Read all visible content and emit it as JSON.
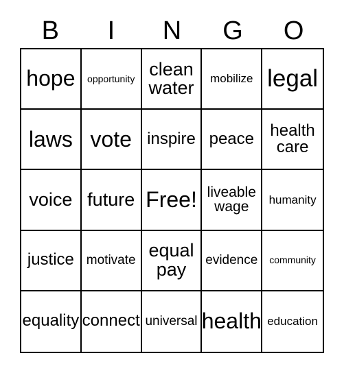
{
  "card": {
    "title": "BINGO",
    "header_letters": [
      "B",
      "I",
      "N",
      "G",
      "O"
    ],
    "border_color": "#000000",
    "background_color": "#ffffff",
    "text_color": "#000000",
    "rows": 5,
    "columns": 5,
    "cells": [
      {
        "text": "hope",
        "size": "lg"
      },
      {
        "text": "opportunity",
        "size": "tiny"
      },
      {
        "text": "clean\nwater",
        "size": "ml"
      },
      {
        "text": "mobilize",
        "size": "xxs"
      },
      {
        "text": "legal",
        "size": "xl"
      },
      {
        "text": "laws",
        "size": "lg"
      },
      {
        "text": "vote",
        "size": "lg"
      },
      {
        "text": "inspire",
        "size": "md"
      },
      {
        "text": "peace",
        "size": "md"
      },
      {
        "text": "health\ncare",
        "size": "md"
      },
      {
        "text": "voice",
        "size": "ml"
      },
      {
        "text": "future",
        "size": "ml"
      },
      {
        "text": "Free!",
        "size": "lg"
      },
      {
        "text": "liveable\nwage",
        "size": "sm"
      },
      {
        "text": "humanity",
        "size": "xxs"
      },
      {
        "text": "justice",
        "size": "md"
      },
      {
        "text": "motivate",
        "size": "xs"
      },
      {
        "text": "equal\npay",
        "size": "ml"
      },
      {
        "text": "evidence",
        "size": "xs"
      },
      {
        "text": "community",
        "size": "tiny"
      },
      {
        "text": "equality",
        "size": "md"
      },
      {
        "text": "connect",
        "size": "md"
      },
      {
        "text": "universal",
        "size": "xs"
      },
      {
        "text": "health",
        "size": "lg"
      },
      {
        "text": "education",
        "size": "xxs"
      }
    ]
  }
}
